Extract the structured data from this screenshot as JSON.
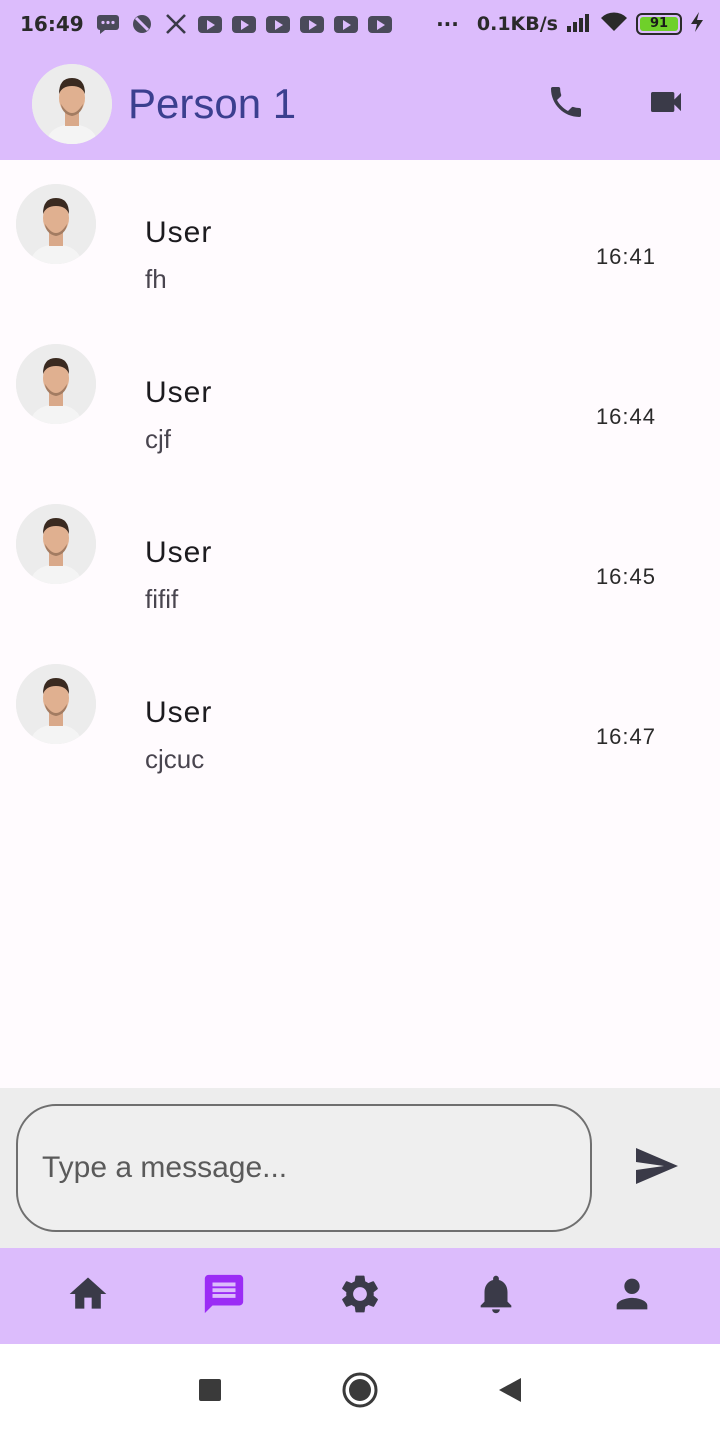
{
  "status_bar": {
    "time": "16:49",
    "network_speed": "0.1KB/s",
    "battery_level": "91",
    "icons": [
      "message-icon",
      "blocked-icon",
      "x-logo-icon",
      "youtube-icon",
      "youtube-icon",
      "youtube-icon",
      "youtube-icon",
      "youtube-icon",
      "youtube-icon",
      "more-dots-icon",
      "signal-icon",
      "wifi-icon",
      "battery-icon",
      "charging-icon"
    ]
  },
  "header": {
    "title": "Person 1",
    "actions": [
      "phone-icon",
      "video-call-icon"
    ]
  },
  "chats": [
    {
      "name": "User",
      "message": "fh",
      "time": "16:41"
    },
    {
      "name": "User",
      "message": "cjf",
      "time": "16:44"
    },
    {
      "name": "User",
      "message": "fifif",
      "time": "16:45"
    },
    {
      "name": "User",
      "message": "cjcuc",
      "time": "16:47"
    }
  ],
  "composer": {
    "placeholder": "Type a message...",
    "value": ""
  },
  "bottom_nav": {
    "items": [
      "home-icon",
      "chat-icon",
      "settings-icon",
      "notifications-icon",
      "profile-icon"
    ],
    "active": "chat-icon"
  },
  "colors": {
    "header_bg": "#dcbcfc",
    "title": "#3b3f8f",
    "active_nav": "#9b2cf5",
    "icon": "#3a3a48"
  }
}
